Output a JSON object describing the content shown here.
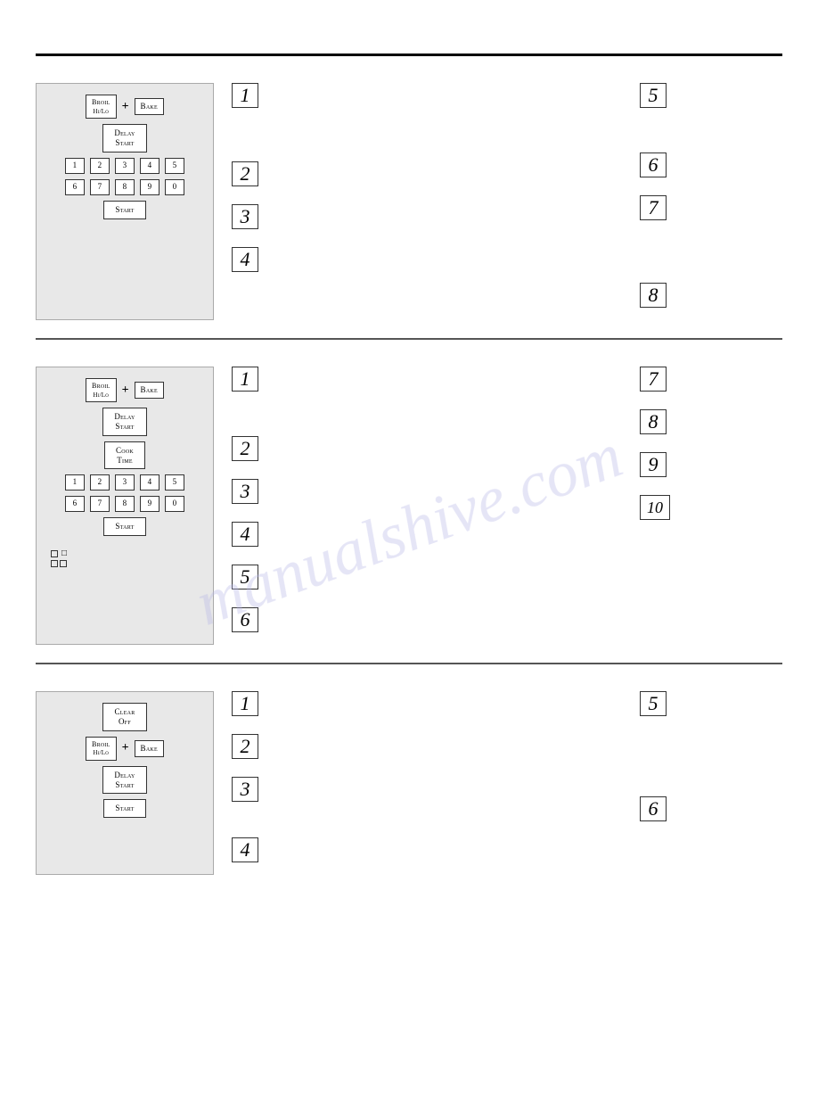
{
  "watermark": "manualshive.com",
  "sections": [
    {
      "id": "section1",
      "panel": {
        "rows": [
          {
            "type": "button-row",
            "items": [
              {
                "label": "Broil\nHi/Lo",
                "class": "btn",
                "sub": true
              },
              {
                "label": "+",
                "class": "plus"
              },
              {
                "label": "Bake",
                "class": "btn"
              }
            ]
          },
          {
            "type": "button-single",
            "label": "Delay\nStart",
            "class": "btn btn-wide"
          },
          {
            "type": "numpad",
            "rows": [
              [
                "1",
                "2",
                "3",
                "4",
                "5"
              ],
              [
                "6",
                "7",
                "8",
                "9",
                "0"
              ]
            ]
          },
          {
            "type": "button-single",
            "label": "Start",
            "class": "btn btn-wide"
          }
        ]
      },
      "steps_left": [
        {
          "num": "1"
        },
        {
          "num": "2"
        },
        {
          "num": "3"
        },
        {
          "num": "4"
        }
      ],
      "steps_right": [
        {
          "num": "5"
        },
        {
          "num": "6"
        },
        {
          "num": "7"
        },
        {
          "num": "8"
        }
      ]
    },
    {
      "id": "section2",
      "panel": {
        "rows": [
          {
            "type": "button-row",
            "items": [
              {
                "label": "Broil\nHi/Lo",
                "sub": true
              },
              {
                "label": "+",
                "class": "plus"
              },
              {
                "label": "Bake"
              }
            ]
          },
          {
            "type": "button-single",
            "label": "Delay\nStart"
          },
          {
            "type": "button-single",
            "label": "Cook\nTime"
          },
          {
            "type": "numpad",
            "rows": [
              [
                "1",
                "2",
                "3",
                "4",
                "5"
              ],
              [
                "6",
                "7",
                "8",
                "9",
                "0"
              ]
            ]
          },
          {
            "type": "button-single",
            "label": "Start"
          }
        ]
      },
      "steps_left": [
        {
          "num": "1"
        },
        {
          "num": "2"
        },
        {
          "num": "3"
        },
        {
          "num": "4"
        },
        {
          "num": "5"
        },
        {
          "num": "6"
        }
      ],
      "steps_right": [
        {
          "num": "7"
        },
        {
          "num": "8"
        },
        {
          "num": "9"
        },
        {
          "num": "10"
        }
      ],
      "extra_symbols": true
    },
    {
      "id": "section3",
      "panel": {
        "rows": [
          {
            "type": "button-single",
            "label": "Clear\nOff"
          },
          {
            "type": "button-row",
            "items": [
              {
                "label": "Broil\nHi/Lo",
                "sub": true
              },
              {
                "label": "+",
                "class": "plus"
              },
              {
                "label": "Bake"
              }
            ]
          },
          {
            "type": "button-single",
            "label": "Delay\nStart"
          },
          {
            "type": "button-single",
            "label": "Start"
          }
        ]
      },
      "steps_left": [
        {
          "num": "1"
        },
        {
          "num": "2"
        },
        {
          "num": "3"
        },
        {
          "num": "4"
        }
      ],
      "steps_right": [
        {
          "num": "5"
        },
        {
          "num": "6"
        }
      ]
    }
  ]
}
